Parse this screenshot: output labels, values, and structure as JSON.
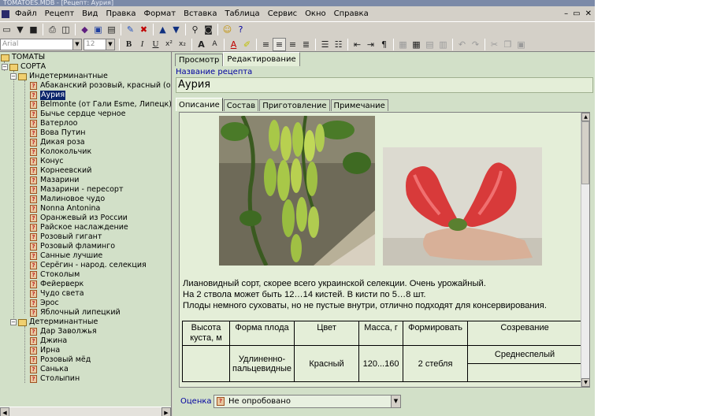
{
  "window": {
    "title": "TOMATOES.MDB - [Рецепт: Аурия]"
  },
  "menu": {
    "items": [
      "Файл",
      "Рецепт",
      "Вид",
      "Правка",
      "Формат",
      "Вставка",
      "Таблица",
      "Сервис",
      "Окно",
      "Справка"
    ],
    "controls": [
      "–",
      "▭",
      "✕"
    ]
  },
  "toolbar": {
    "font_name": "Arial",
    "font_size": "12",
    "bold": "B",
    "italic": "I",
    "underline": "U",
    "superscript": "x²",
    "subscript": "x₂",
    "grow_font": "A",
    "shrink_font": "A"
  },
  "tree": {
    "root": "ТОМАТЫ",
    "sorts": "СОРТА",
    "group_indeterminate": "Индетерминантные",
    "indeterminate": [
      "Абаканский розовый, красный (о",
      "Аурия",
      "Belmonte (от Гали Esme, Липецк)",
      "Бычье сердце черное",
      "Ватерлоо",
      "Вова Путин",
      "Дикая роза",
      "Колокольчик",
      "Конус",
      "Корнеевский",
      "Мазарини",
      "Мазарини - пересорт",
      "Малиновое чудо",
      "Nonna Antonina",
      "Оранжевый из России",
      "Райское наслаждение",
      "Розовый гигант",
      "Розовый фламинго",
      "Санные лучшие",
      "Серёгин - народ. селекция",
      "Стоколым",
      "Фейерверк",
      "Чудо света",
      "Эрос",
      "Яблочный липецкий"
    ],
    "group_determinate": "Детерминантные",
    "determinate": [
      "Дар Заволжья",
      "Джина",
      "Ирна",
      "Розовый мёд",
      "Санька",
      "Столыпин"
    ],
    "selected": "Аурия"
  },
  "view_tabs": {
    "preview": "Просмотр",
    "edit": "Редактирование"
  },
  "recipe": {
    "name_label": "Название рецепта",
    "name": "Аурия"
  },
  "page_tabs": {
    "description": "Описание",
    "composition": "Состав",
    "preparation": "Приготовление",
    "note": "Примечание"
  },
  "description": {
    "line1": "Лиановидный сорт, скорее всего украинской селекции. Очень урожайный.",
    "line2": "На 2 ствола может быть 12…14 кистей.  В кисти по 5…8 шт.",
    "line3": "Плоды немного суховаты, но не пустые внутри, отлично подходят для консервирования."
  },
  "props_table": {
    "headers": [
      "Высота куста, м",
      "Форма плода",
      "Цвет",
      "Масса, г",
      "Формировать",
      "Созревание"
    ],
    "values": [
      "",
      "Удлиненно-пальцевидные",
      "Красный",
      "120...160",
      "2 стебля",
      "Среднеспелый"
    ]
  },
  "rating": {
    "label": "Оценка",
    "value": "Не опробовано"
  }
}
